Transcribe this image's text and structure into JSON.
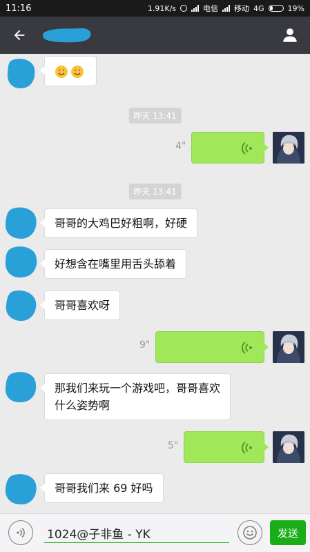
{
  "status_bar": {
    "time": "11:16",
    "speed": "1.91K/s",
    "carrier1": "电信",
    "carrier2": "移动",
    "network": "4G",
    "battery": "19%"
  },
  "title_bar": {
    "back_icon": "back-arrow-icon",
    "profile_icon": "user-icon"
  },
  "messages": {
    "first": {
      "emoji_icon": "heart-eyes-emoji"
    },
    "ts1": "昨天 13:41",
    "voice1_duration": "4\"",
    "ts2": "昨天 13:41",
    "text1": "哥哥的大鸡巴好粗啊，好硬",
    "text2": "好想含在嘴里用舌头舔着",
    "text3": "哥哥喜欢呀",
    "voice2_duration": "9\"",
    "text4_line1": "那我们来玩一个游戏吧，哥哥喜欢",
    "text4_line2": "什么姿势啊",
    "voice3_duration": "5\"",
    "text5": "哥哥我们来 69 好吗"
  },
  "input_bar": {
    "value": "1024@子非鱼 - YK",
    "send_label": "发送",
    "voice_icon": "voice-input-icon",
    "emoji_icon": "smiley-icon"
  },
  "colors": {
    "title_bg": "#393a3f",
    "chat_bg": "#ebebeb",
    "voice_bubble": "#a0e759",
    "send_button": "#1aad19",
    "avatar_blot": "#29a0d8"
  }
}
